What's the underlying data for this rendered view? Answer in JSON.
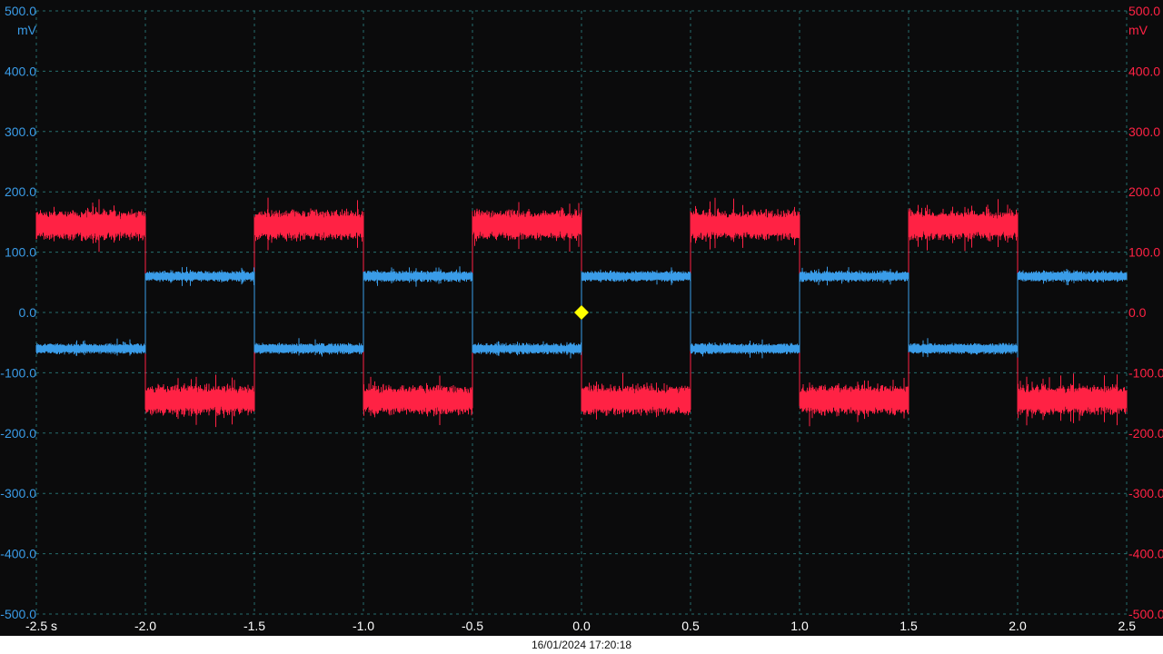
{
  "colors": {
    "background": "#0b0b0c",
    "grid": "#2f8f8f",
    "channel_a": "#3a9ce8",
    "channel_b": "#ff2244",
    "trigger_marker": "#ffff00",
    "x_axis_text": "#ffffff",
    "footer_bg": "#ffffff"
  },
  "footer": {
    "timestamp": "16/01/2024 17:20:18"
  },
  "chart_data": {
    "type": "line",
    "title": "",
    "xlabel": "",
    "ylabel": "",
    "x_unit": "s",
    "y_unit": "mV",
    "xlim": [
      -2.5,
      2.5
    ],
    "ylim": [
      -500,
      500
    ],
    "grid": true,
    "x_ticks": [
      -2.5,
      -2.0,
      -1.5,
      -1.0,
      -0.5,
      0.0,
      0.5,
      1.0,
      1.5,
      2.0,
      2.5
    ],
    "x_tick_labels": [
      "-2.5 s",
      "-2.0",
      "-1.5",
      "-1.0",
      "-0.5",
      "0.0",
      "0.5",
      "1.0",
      "1.5",
      "2.0",
      "2.5"
    ],
    "y_ticks": [
      500,
      400,
      300,
      200,
      100,
      0,
      -100,
      -200,
      -300,
      -400,
      -500
    ],
    "y_tick_labels": [
      "500.0",
      "400.0",
      "300.0",
      "200.0",
      "100.0",
      "0.0",
      "-100.0",
      "-200.0",
      "-300.0",
      "-400.0",
      "-500.0"
    ],
    "trigger": {
      "x": 0.0,
      "y": 0.0
    },
    "series": [
      {
        "id": "channel_a",
        "axis": "left",
        "color": "#3a9ce8",
        "noise_mV": 10,
        "x": [
          -2.5,
          -2.0,
          -2.0,
          -1.5,
          -1.5,
          -1.0,
          -1.0,
          -0.5,
          -0.5,
          0.0,
          0.0,
          0.5,
          0.5,
          1.0,
          1.0,
          1.5,
          1.5,
          2.0,
          2.0,
          2.5
        ],
        "y": [
          -60,
          -60,
          60,
          60,
          -60,
          -60,
          60,
          60,
          -60,
          -60,
          60,
          60,
          -60,
          -60,
          60,
          60,
          -60,
          -60,
          60,
          60
        ]
      },
      {
        "id": "channel_b",
        "axis": "right",
        "color": "#ff2244",
        "noise_mV": 28,
        "x": [
          -2.5,
          -2.0,
          -2.0,
          -1.5,
          -1.5,
          -1.0,
          -1.0,
          -0.5,
          -0.5,
          0.0,
          0.0,
          0.5,
          0.5,
          1.0,
          1.0,
          1.5,
          1.5,
          2.0,
          2.0,
          2.5
        ],
        "y": [
          145,
          145,
          -145,
          -145,
          145,
          145,
          -145,
          -145,
          145,
          145,
          -145,
          -145,
          145,
          145,
          -145,
          -145,
          145,
          145,
          -145,
          -145
        ]
      }
    ]
  }
}
